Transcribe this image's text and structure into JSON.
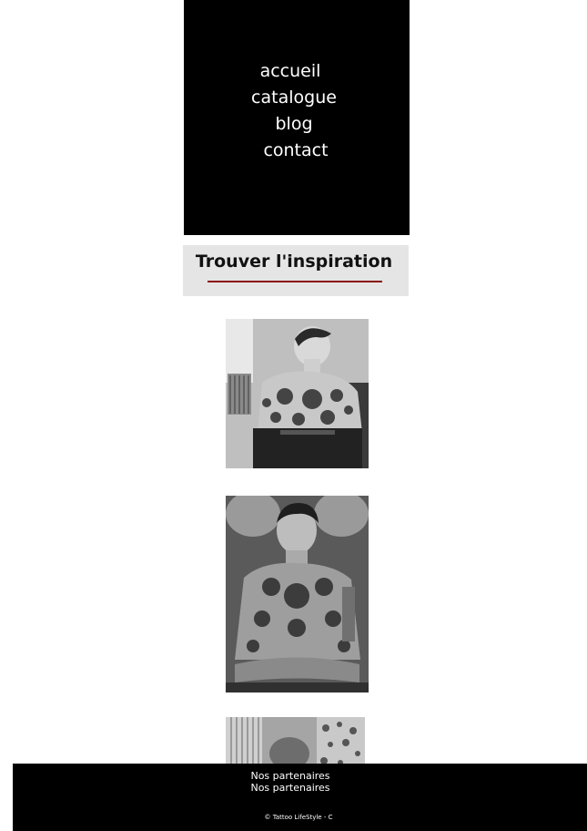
{
  "nav": {
    "items": [
      {
        "label": "accueil"
      },
      {
        "label": "catalogue"
      },
      {
        "label": "blog"
      },
      {
        "label": "contact"
      }
    ]
  },
  "hero": {
    "title": "Trouver l'inspiration",
    "accent_color": "#8b0f0f"
  },
  "gallery": {
    "images": [
      {
        "icon": "tattooed-man-profile-photo"
      },
      {
        "icon": "tattooed-man-portrait-photo"
      },
      {
        "icon": "tattoo-parlor-photo"
      }
    ]
  },
  "footer": {
    "partners": [
      "Nos partenaires",
      "Nos partenaires"
    ],
    "copyright": "© Tattoo LifeStyle - C"
  },
  "colors": {
    "nav_bg": "#000000",
    "hero_bg": "#e5e5e5",
    "footer_bg": "#000000",
    "text_light": "#ffffff"
  }
}
